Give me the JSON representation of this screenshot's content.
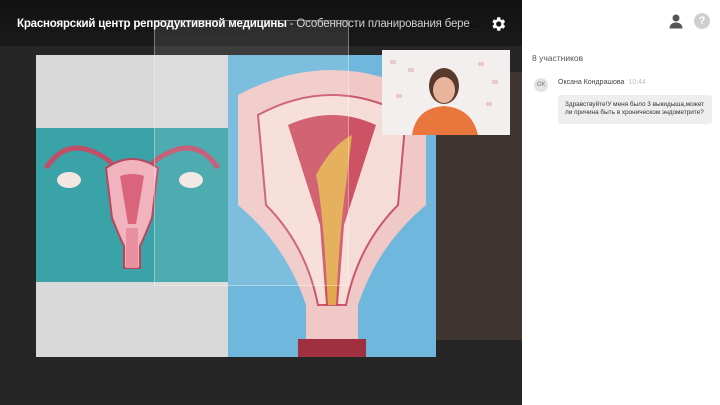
{
  "video": {
    "channel": "Красноярский центр репродуктивной медицины",
    "separator": " - ",
    "title": "Особенности планирования беременности пос…"
  },
  "chat": {
    "participants": "8 участников",
    "message": {
      "author": "Оксана Кондрашова",
      "avatar_initials": "ОК",
      "time": "10:44",
      "text": "Здравствуйте!У меня было 3 выкидыша,может ли причина быть в хроническом эндометрите?"
    }
  },
  "icons": {
    "settings": "gear-icon",
    "user": "user-icon",
    "help": "help-icon"
  },
  "colors": {
    "player_bg": "#262626",
    "panel_bg": "#ffffff",
    "teal": "#3aa3a8",
    "slide_blue": "#6fb7dc"
  }
}
